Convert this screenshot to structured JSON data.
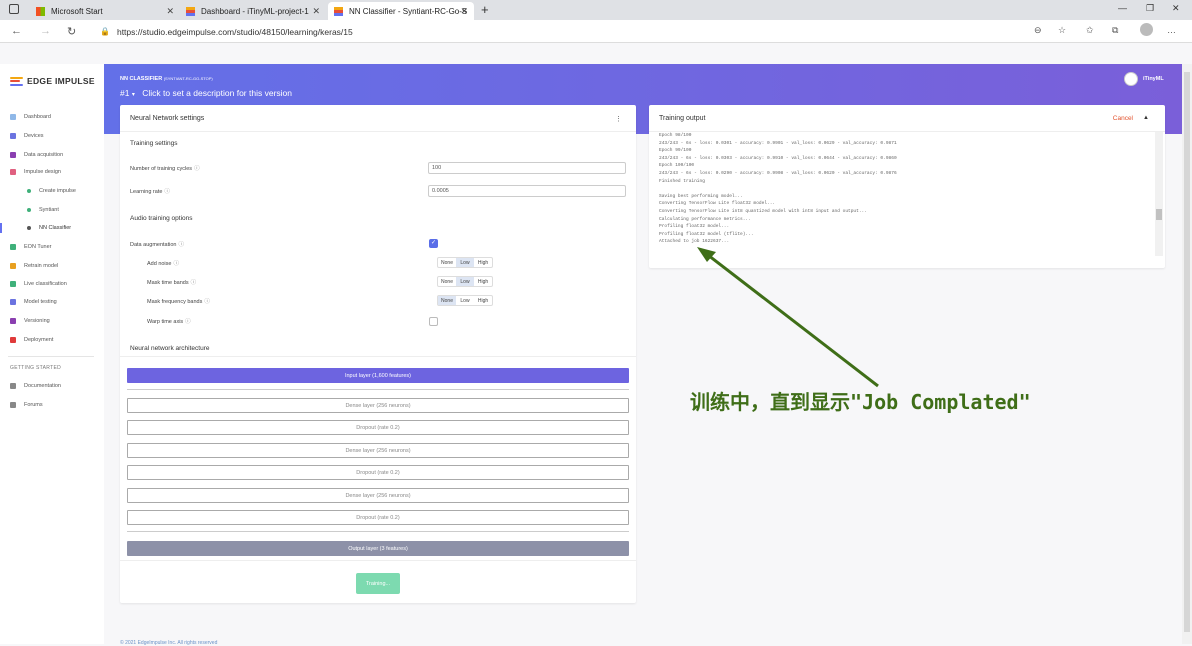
{
  "browser": {
    "tabs": [
      {
        "label": "Microsoft Start"
      },
      {
        "label": "Dashboard - iTinyML-project-1"
      },
      {
        "label": "NN Classifier - Syntiant-RC-Go-S"
      }
    ],
    "url": "https://studio.edgeimpulse.com/studio/48150/learning/keras/15"
  },
  "sidebar": {
    "logo": "EDGE IMPULSE",
    "items": [
      {
        "label": "Dashboard",
        "color": "#8fb8e8"
      },
      {
        "label": "Devices",
        "color": "#6b73e0"
      },
      {
        "label": "Data acquisition",
        "color": "#8a3fb0"
      },
      {
        "label": "Impulse design",
        "color": "#e06080"
      },
      {
        "label": "Create impulse",
        "color": "#3fb07a"
      },
      {
        "label": "Syntiant",
        "color": "#3fb07a"
      },
      {
        "label": "NN Classifier",
        "color": "#555555"
      },
      {
        "label": "EON Tuner",
        "color": "#3fb07a"
      },
      {
        "label": "Retrain model",
        "color": "#e8a020"
      },
      {
        "label": "Live classification",
        "color": "#3fb07a"
      },
      {
        "label": "Model testing",
        "color": "#6b73e0"
      },
      {
        "label": "Versioning",
        "color": "#8a3fb0"
      },
      {
        "label": "Deployment",
        "color": "#e03a3a"
      }
    ],
    "getting_started": "GETTING STARTED",
    "extra": [
      {
        "label": "Documentation"
      },
      {
        "label": "Forums"
      }
    ]
  },
  "header": {
    "title": "NN CLASSIFIER",
    "project": "(SYNTIANT-RC-GO-STOP)",
    "version": "#1",
    "description": "Click to set a description for this version",
    "user": "iTinyML"
  },
  "settings": {
    "title": "Neural Network settings",
    "training_settings": "Training settings",
    "cycles_label": "Number of training cycles",
    "cycles_value": "100",
    "lr_label": "Learning rate",
    "lr_value": "0.0005",
    "audio_options": "Audio training options",
    "augmentation_label": "Data augmentation",
    "add_noise": "Add noise",
    "mask_time": "Mask time bands",
    "mask_freq": "Mask frequency bands",
    "warp_time": "Warp time axis",
    "seg_none": "None",
    "seg_low": "Low",
    "seg_high": "High",
    "architecture": "Neural network architecture",
    "layers": [
      "Input layer (1,600 features)",
      "Dense layer (256 neurons)",
      "Dropout (rate 0.2)",
      "Dense layer (256 neurons)",
      "Dropout (rate 0.2)",
      "Dense layer (256 neurons)",
      "Dropout (rate 0.2)",
      "Output layer (3 features)"
    ],
    "button": "Training..."
  },
  "output": {
    "title": "Training output",
    "cancel": "Cancel",
    "lines": [
      "Epoch 98/100",
      "243/243 - 6s - loss: 0.0301 - accuracy: 0.9901 - val_loss: 0.0629 - val_accuracy: 0.9871",
      "Epoch 99/100",
      "243/243 - 6s - loss: 0.0303 - accuracy: 0.9910 - val_loss: 0.0644 - val_accuracy: 0.9860",
      "Epoch 100/100",
      "243/243 - 6s - loss: 0.0290 - accuracy: 0.9908 - val_loss: 0.0620 - val_accuracy: 0.9876",
      "Finished training",
      "",
      "Saving best performing model...",
      "Converting TensorFlow Lite float32 model...",
      "Converting TensorFlow Lite int8 quantized model with int8 input and output...",
      "Calculating performance metrics...",
      "Profiling float32 model...",
      "Profiling float32 model (tflite)...",
      "Attached to job 1622637..."
    ]
  },
  "annotation": "训练中，直到显示\"Job Complated\"",
  "footer": "© 2021 EdgeImpulse Inc. All rights reserved"
}
